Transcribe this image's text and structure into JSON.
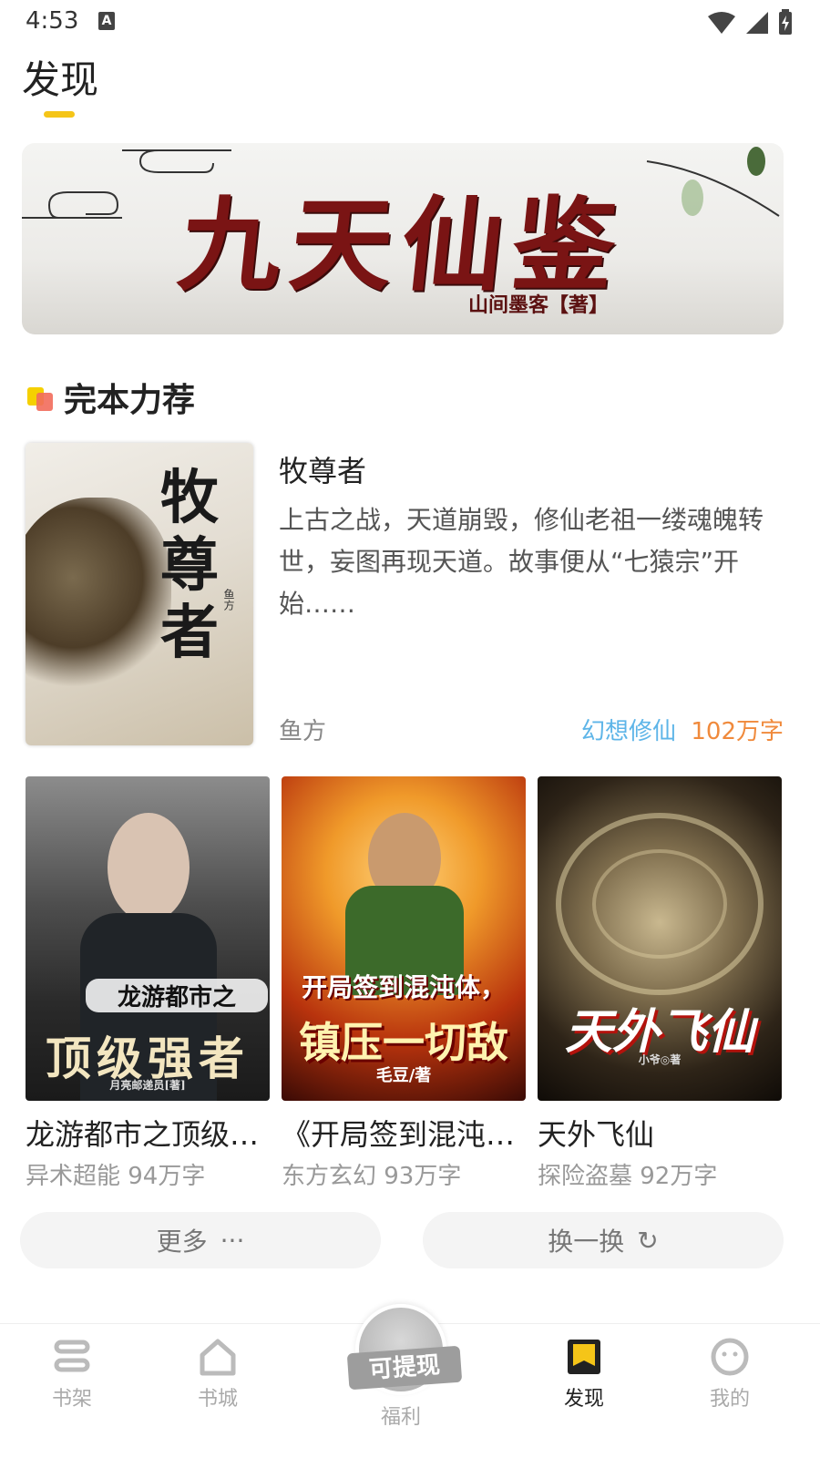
{
  "status": {
    "time": "4:53",
    "indicator": "A"
  },
  "header": {
    "title": "发现"
  },
  "banner": {
    "title": "九天仙鉴",
    "author": "山间墨客【著】"
  },
  "section": {
    "title": "完本力荐"
  },
  "featured": {
    "cover_text": "牧尊者",
    "cover_author": "鱼方",
    "name": "牧尊者",
    "description": "上古之战，天道崩毁，修仙老祖一缕魂魄转世，妄图再现天道。故事便从“七猿宗”开始……",
    "author": "鱼方",
    "genre": "幻想修仙",
    "words": "102万字"
  },
  "books": [
    {
      "name": "龙游都市之顶级强者",
      "meta": "异术超能 94万字",
      "cover_top": "龙游都市之",
      "cover_main": "顶级强者",
      "cover_author": "月亮邮递员[著]"
    },
    {
      "name": "《开局签到混沌体，镇压一切敌》",
      "meta": "东方玄幻 93万字",
      "cover_top": "开局签到混沌体，",
      "cover_main": "镇压一切敌",
      "cover_author": "毛豆/著"
    },
    {
      "name": "天外飞仙",
      "meta": "探险盗墓 92万字",
      "cover_main": "天外飞仙",
      "cover_author": "小爷◎著"
    }
  ],
  "actions": {
    "more": "更多",
    "more_icon": "···",
    "refresh": "换一换",
    "refresh_icon": "↻"
  },
  "nav": {
    "items": [
      {
        "label": "书架",
        "icon": "bookshelf-icon"
      },
      {
        "label": "书城",
        "icon": "bookstore-icon"
      },
      {
        "label": "福利",
        "icon": "withdraw-icon",
        "badge": "可提现"
      },
      {
        "label": "发现",
        "icon": "discover-icon",
        "active": true
      },
      {
        "label": "我的",
        "icon": "profile-icon"
      }
    ]
  },
  "colors": {
    "accent": "#f5c518",
    "genre": "#5eb5e8",
    "words": "#f08a3c"
  }
}
